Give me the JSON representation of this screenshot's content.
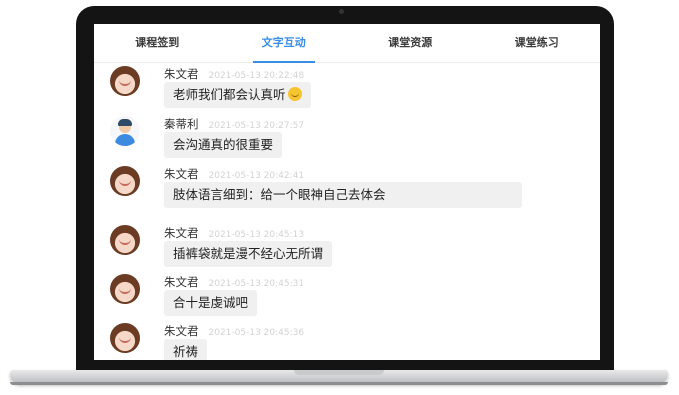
{
  "tabs": [
    "课程签到",
    "文字互动",
    "课堂资源",
    "课堂练习"
  ],
  "active_tab": "文字互动",
  "messages": [
    {
      "name": "朱文君",
      "time": "2021-05-13 20:22:48",
      "text": "老师我们都会认真听",
      "emoji": "smile-emoji"
    },
    {
      "name": "秦蒂利",
      "time": "2021-05-13 20:27:57",
      "text": "会沟通真的很重要"
    },
    {
      "name": "朱文君",
      "time": "2021-05-13 20:42:41",
      "text": "肢体语言细到：给一个眼神自己去体会"
    },
    {
      "name": "朱文君",
      "time": "2021-05-13 20:45:13",
      "text": "插裤袋就是漫不经心无所谓"
    },
    {
      "name": "朱文君",
      "time": "2021-05-13 20:45:31",
      "text": "合十是虔诚吧"
    },
    {
      "name": "朱文君",
      "time": "2021-05-13 20:45:36",
      "text": "祈祷"
    }
  ],
  "colors": {
    "accent": "#3a8ee6",
    "bubble": "#f0f0f0",
    "frame": "#141414"
  }
}
